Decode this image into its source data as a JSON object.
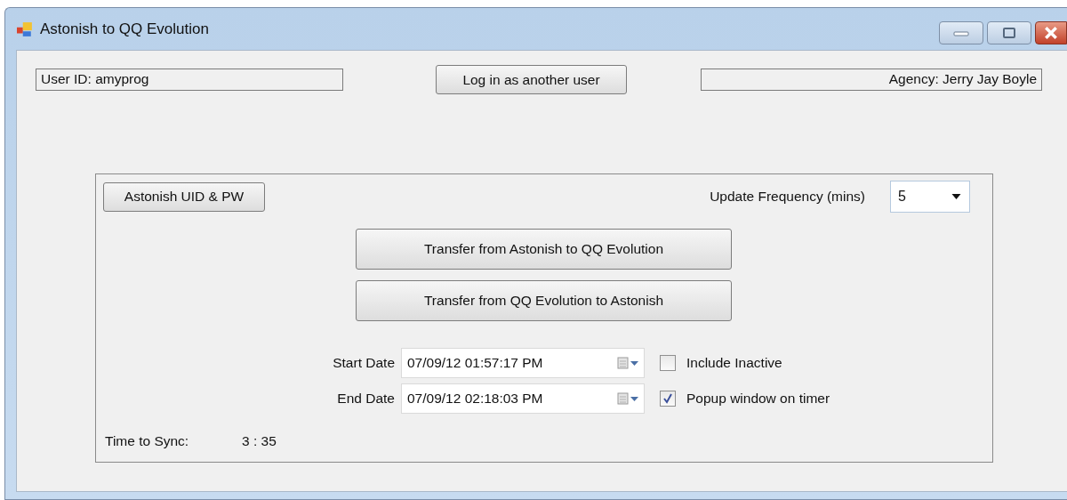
{
  "window": {
    "title": "Astonish to QQ Evolution"
  },
  "user_id": "User ID: amyprog",
  "login_button": "Log in as another user",
  "agency": "Agency: Jerry Jay Boyle",
  "credentials_button": "Astonish UID & PW",
  "update_frequency": {
    "label": "Update Frequency (mins)",
    "value": "5"
  },
  "transfer_buttons": [
    "Transfer from Astonish to QQ Evolution",
    "Transfer from QQ Evolution to Astonish"
  ],
  "dates": [
    {
      "label": "Start Date",
      "value": "07/09/12 01:57:17 PM"
    },
    {
      "label": "End Date",
      "value": "07/09/12 02:18:03 PM"
    }
  ],
  "options": [
    {
      "label": "Include Inactive",
      "checked": false
    },
    {
      "label": "Popup window on timer",
      "checked": true
    }
  ],
  "sync": {
    "label": "Time to Sync:",
    "value": "3 : 35"
  }
}
